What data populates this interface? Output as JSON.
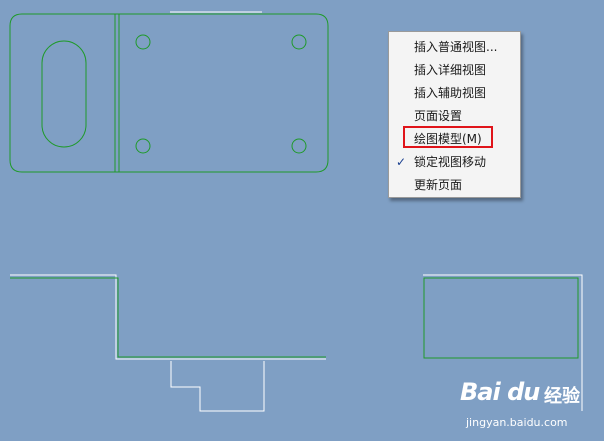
{
  "context_menu": {
    "items": [
      {
        "label": "插入普通视图...",
        "checked": false
      },
      {
        "label": "插入详细视图",
        "checked": false
      },
      {
        "label": "插入辅助视图",
        "checked": false
      },
      {
        "label": "页面设置",
        "checked": false
      },
      {
        "label": "绘图模型(M)",
        "checked": false,
        "highlighted": true
      },
      {
        "label": "锁定视图移动",
        "checked": true
      },
      {
        "label": "更新页面",
        "checked": false
      }
    ],
    "check_glyph": "✓"
  },
  "watermark": {
    "brand": "Bai du",
    "brand_cn": "经验",
    "url": "jingyan.baidu.com"
  },
  "colors": {
    "background": "#7f9fc4",
    "drawing_green": "#1f9a2a",
    "drawing_white": "#ffffff",
    "highlight_red": "#e0141a"
  }
}
